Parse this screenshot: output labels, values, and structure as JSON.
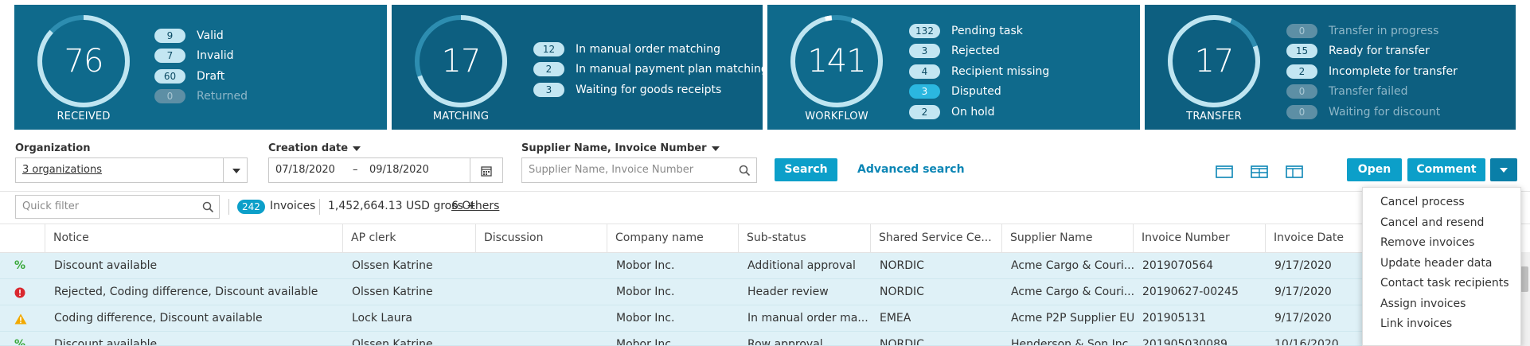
{
  "kpis": [
    {
      "title": "RECEIVED",
      "number": "76",
      "stats": [
        {
          "count": "9",
          "label": "Valid"
        },
        {
          "count": "7",
          "label": "Invalid"
        },
        {
          "count": "60",
          "label": "Draft"
        },
        {
          "count": "0",
          "label": "Returned"
        }
      ]
    },
    {
      "title": "MATCHING",
      "number": "17",
      "stats": [
        {
          "count": "12",
          "label": "In manual order matching"
        },
        {
          "count": "2",
          "label": "In manual payment plan matching"
        },
        {
          "count": "3",
          "label": "Waiting for goods receipts"
        }
      ]
    },
    {
      "title": "WORKFLOW",
      "number": "141",
      "stats": [
        {
          "count": "132",
          "label": "Pending task"
        },
        {
          "count": "3",
          "label": "Rejected"
        },
        {
          "count": "4",
          "label": "Recipient missing"
        },
        {
          "count": "3",
          "label": "Disputed"
        },
        {
          "count": "2",
          "label": "On hold"
        }
      ]
    },
    {
      "title": "TRANSFER",
      "number": "17",
      "stats": [
        {
          "count": "0",
          "label": "Transfer in progress"
        },
        {
          "count": "15",
          "label": "Ready for transfer"
        },
        {
          "count": "2",
          "label": "Incomplete for transfer"
        },
        {
          "count": "0",
          "label": "Transfer failed"
        },
        {
          "count": "0",
          "label": "Waiting for discount"
        }
      ]
    }
  ],
  "filters": {
    "organization_label": "Organization",
    "organization_value": "3 organizations",
    "creation_date_label": "Creation date",
    "date_from": "07/18/2020",
    "date_sep": "–",
    "date_to": "09/18/2020",
    "supplier_label": "Supplier Name, Invoice Number",
    "supplier_placeholder": "Supplier Name, Invoice Number",
    "search_button": "Search",
    "advanced_search": "Advanced search"
  },
  "actions": {
    "open": "Open",
    "comment": "Comment"
  },
  "summary": {
    "quick_filter_placeholder": "Quick filter",
    "count": "242",
    "count_label": "Invoices",
    "amount": "1,452,664.13 USD gross +",
    "others": "6 Others"
  },
  "columns": [
    "Notice",
    "AP clerk",
    "Discussion",
    "Company name",
    "Sub-status",
    "Shared Service Ce...",
    "Supplier Name",
    "Invoice Number",
    "Invoice Date"
  ],
  "rows": [
    {
      "icon": "percent",
      "notice": "Discount available",
      "clerk": "Olssen Katrine",
      "discussion": "",
      "company": "Mobor Inc.",
      "substatus": "Additional approval",
      "ssc": "NORDIC",
      "supplier": "Acme Cargo & Couri...",
      "invoice": "2019070564",
      "date": "9/17/2020"
    },
    {
      "icon": "error",
      "notice": "Rejected, Coding difference, Discount available",
      "clerk": "Olssen Katrine",
      "discussion": "",
      "company": "Mobor Inc.",
      "substatus": "Header review",
      "ssc": "NORDIC",
      "supplier": "Acme Cargo & Couri...",
      "invoice": "20190627-00245",
      "date": "9/17/2020"
    },
    {
      "icon": "warning",
      "notice": "Coding difference, Discount available",
      "clerk": "Lock Laura",
      "discussion": "",
      "company": "Mobor Inc.",
      "substatus": "In manual order ma...",
      "ssc": "EMEA",
      "supplier": "Acme P2P Supplier EU",
      "invoice": "2019051­31",
      "date": "9/17/2020"
    },
    {
      "icon": "percent",
      "notice": "Discount available",
      "clerk": "Olssen Katrine",
      "discussion": "",
      "company": "Mobor Inc.",
      "substatus": "Row approval",
      "ssc": "NORDIC",
      "supplier": "Henderson & Son Inc.",
      "invoice": "2019050300­89",
      "date": "10/16/2020"
    }
  ],
  "menu": [
    "Cancel process",
    "Cancel and resend",
    "Remove invoices",
    "Update header data",
    "Contact task recipients",
    "Assign invoices",
    "Link invoices"
  ],
  "colors": {
    "tile": "#0f6a8c",
    "accent": "#0c9fc9",
    "row_highlight": "#dff1f7"
  }
}
